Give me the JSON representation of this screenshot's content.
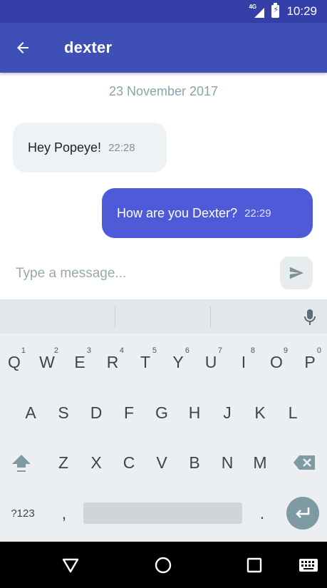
{
  "status_bar": {
    "network_label": "4G",
    "battery_label": "⚡",
    "time": "10:29"
  },
  "app_bar": {
    "title": "dexter"
  },
  "chat": {
    "date_separator": "23 November 2017",
    "messages": [
      {
        "direction": "incoming",
        "text": "Hey Popeye!",
        "time": "22:28"
      },
      {
        "direction": "outgoing",
        "text": "How are you Dexter?",
        "time": "22:29"
      }
    ]
  },
  "composer": {
    "placeholder": "Type a message..."
  },
  "keyboard": {
    "row1": [
      {
        "key": "Q",
        "hint": "1"
      },
      {
        "key": "W",
        "hint": "2"
      },
      {
        "key": "E",
        "hint": "3"
      },
      {
        "key": "R",
        "hint": "4"
      },
      {
        "key": "T",
        "hint": "5"
      },
      {
        "key": "Y",
        "hint": "6"
      },
      {
        "key": "U",
        "hint": "7"
      },
      {
        "key": "I",
        "hint": "8"
      },
      {
        "key": "O",
        "hint": "9"
      },
      {
        "key": "P",
        "hint": "0"
      }
    ],
    "row2": [
      "A",
      "S",
      "D",
      "F",
      "G",
      "H",
      "J",
      "K",
      "L"
    ],
    "row3": [
      "Z",
      "X",
      "C",
      "V",
      "B",
      "N",
      "M"
    ],
    "symbols_label": "?123",
    "comma_label": ",",
    "period_label": "."
  },
  "colors": {
    "primary": "#3f4fb8",
    "primary_dark": "#3440a8",
    "outgoing_bubble": "#4e5ad8",
    "incoming_bubble": "#eff2f5"
  }
}
